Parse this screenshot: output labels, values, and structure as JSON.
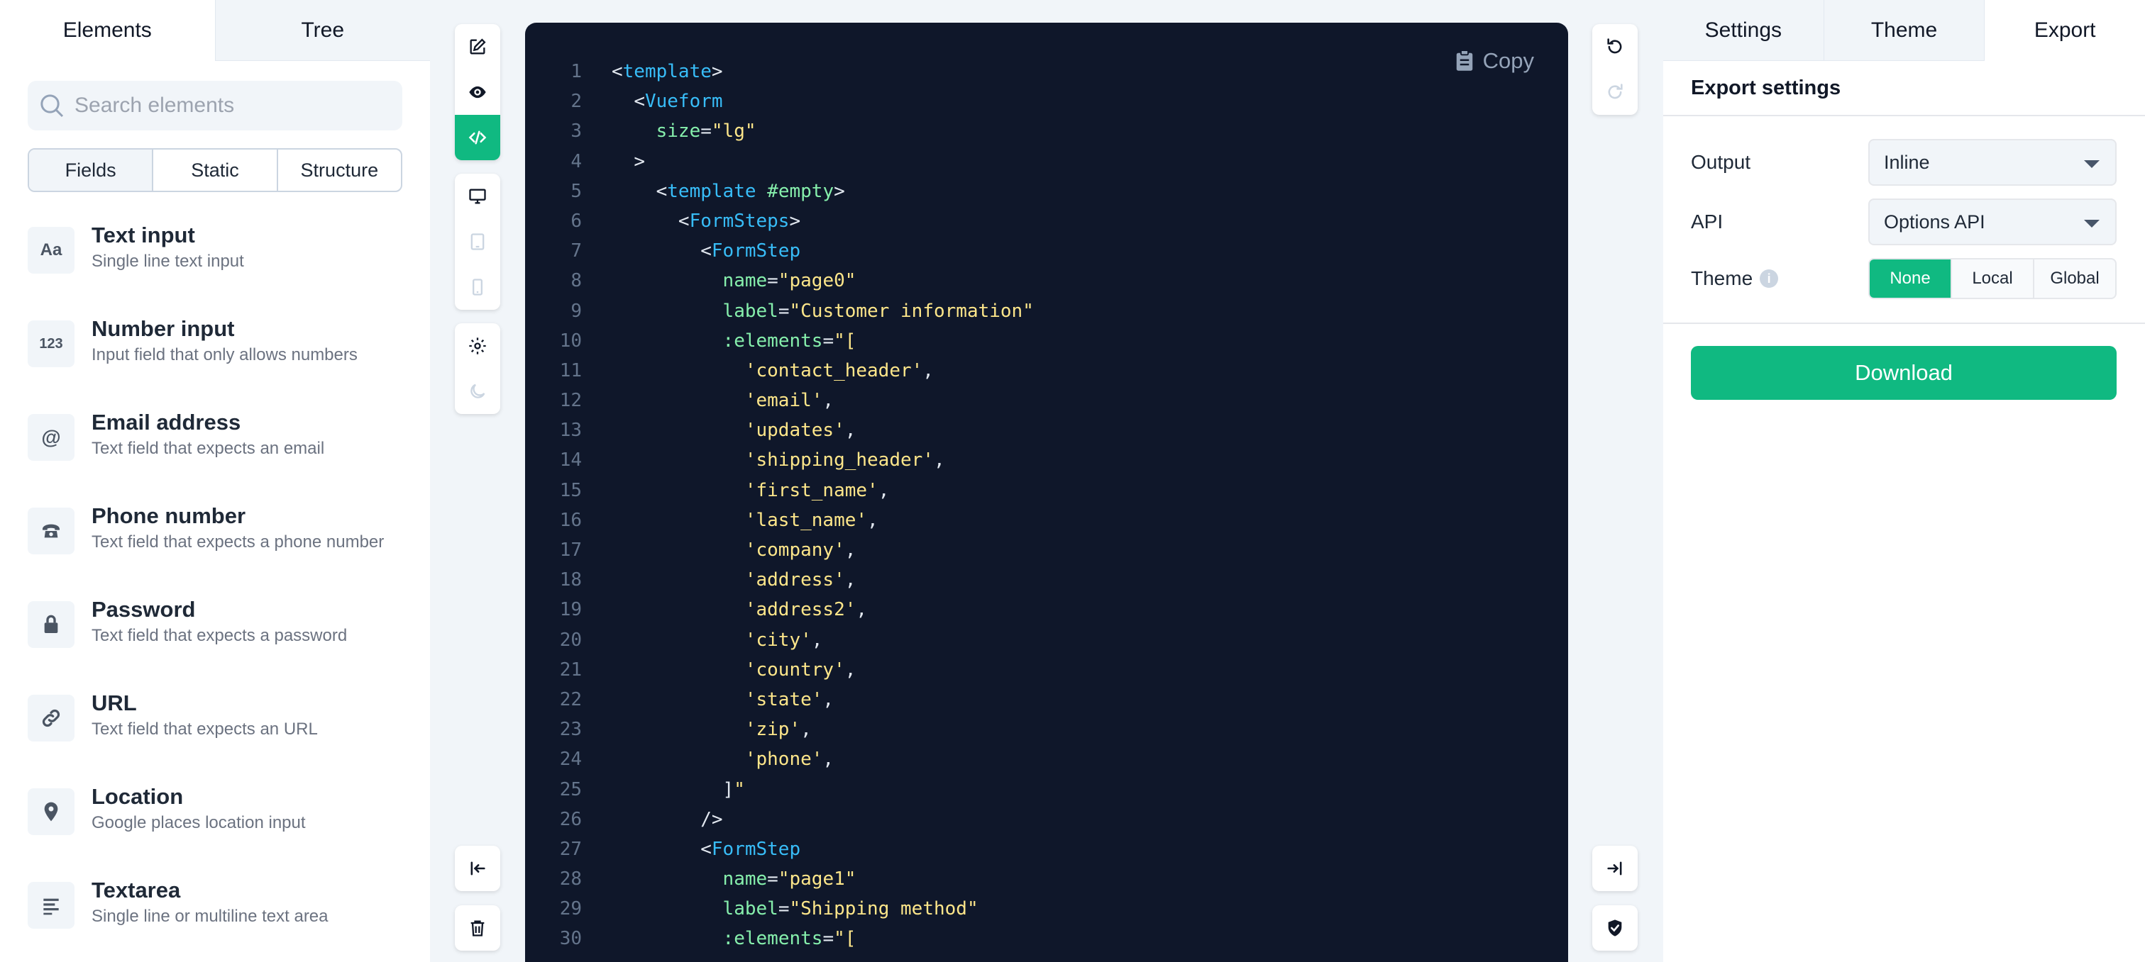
{
  "left_panel": {
    "tabs": [
      "Elements",
      "Tree"
    ],
    "search_placeholder": "Search elements",
    "segments": [
      "Fields",
      "Static",
      "Structure"
    ],
    "elements": [
      {
        "icon": "text-icon",
        "glyph": "Aa",
        "title": "Text input",
        "desc": "Single line text input"
      },
      {
        "icon": "number-icon",
        "glyph": "123",
        "title": "Number input",
        "desc": "Input field that only allows numbers"
      },
      {
        "icon": "at-icon",
        "glyph": "@",
        "title": "Email address",
        "desc": "Text field that expects an email"
      },
      {
        "icon": "phone-icon",
        "glyph": "",
        "title": "Phone number",
        "desc": "Text field that expects a phone number"
      },
      {
        "icon": "lock-icon",
        "glyph": "",
        "title": "Password",
        "desc": "Text field that expects a password"
      },
      {
        "icon": "link-icon",
        "glyph": "",
        "title": "URL",
        "desc": "Text field that expects an URL"
      },
      {
        "icon": "location-pin-icon",
        "glyph": "",
        "title": "Location",
        "desc": "Google places location input"
      },
      {
        "icon": "align-left-icon",
        "glyph": "",
        "title": "Textarea",
        "desc": "Single line or multiline text area"
      }
    ]
  },
  "toolbar_left": {
    "mode_icons": [
      "edit-icon",
      "eye-icon",
      "code-icon"
    ],
    "device_icons": [
      "desktop-icon",
      "tablet-icon",
      "mobile-icon"
    ],
    "misc_icons": [
      "gear-icon",
      "moon-icon"
    ],
    "bottom_icons": [
      "collapse-left-icon",
      "trash-icon"
    ]
  },
  "toolbar_right": {
    "top_icons": [
      "undo-icon",
      "redo-icon"
    ],
    "bottom_icons": [
      "collapse-right-icon",
      "shield-check-icon"
    ]
  },
  "editor": {
    "copy_label": "Copy",
    "lines": [
      "<template>",
      "  <Vueform",
      "    size=\"lg\"",
      "  >",
      "    <template #empty>",
      "      <FormSteps>",
      "        <FormStep",
      "          name=\"page0\"",
      "          label=\"Customer information\"",
      "          :elements=\"[",
      "            'contact_header',",
      "            'email',",
      "            'updates',",
      "            'shipping_header',",
      "            'first_name',",
      "            'last_name',",
      "            'company',",
      "            'address',",
      "            'address2',",
      "            'city',",
      "            'country',",
      "            'state',",
      "            'zip',",
      "            'phone',",
      "          ]\"",
      "        />",
      "        <FormStep",
      "          name=\"page1\"",
      "          label=\"Shipping method\"",
      "          :elements=\"["
    ]
  },
  "right_panel": {
    "tabs": [
      "Settings",
      "Theme",
      "Export"
    ],
    "header": "Export settings",
    "output_label": "Output",
    "output_value": "Inline",
    "api_label": "API",
    "api_value": "Options API",
    "theme_label": "Theme",
    "theme_info": "i",
    "theme_options": [
      "None",
      "Local",
      "Global"
    ],
    "download_label": "Download"
  },
  "colors": {
    "accent": "#10b981",
    "editor_bg": "#0f172a",
    "tag": "#38bdf8",
    "attr": "#86efac",
    "string": "#fde68a"
  }
}
